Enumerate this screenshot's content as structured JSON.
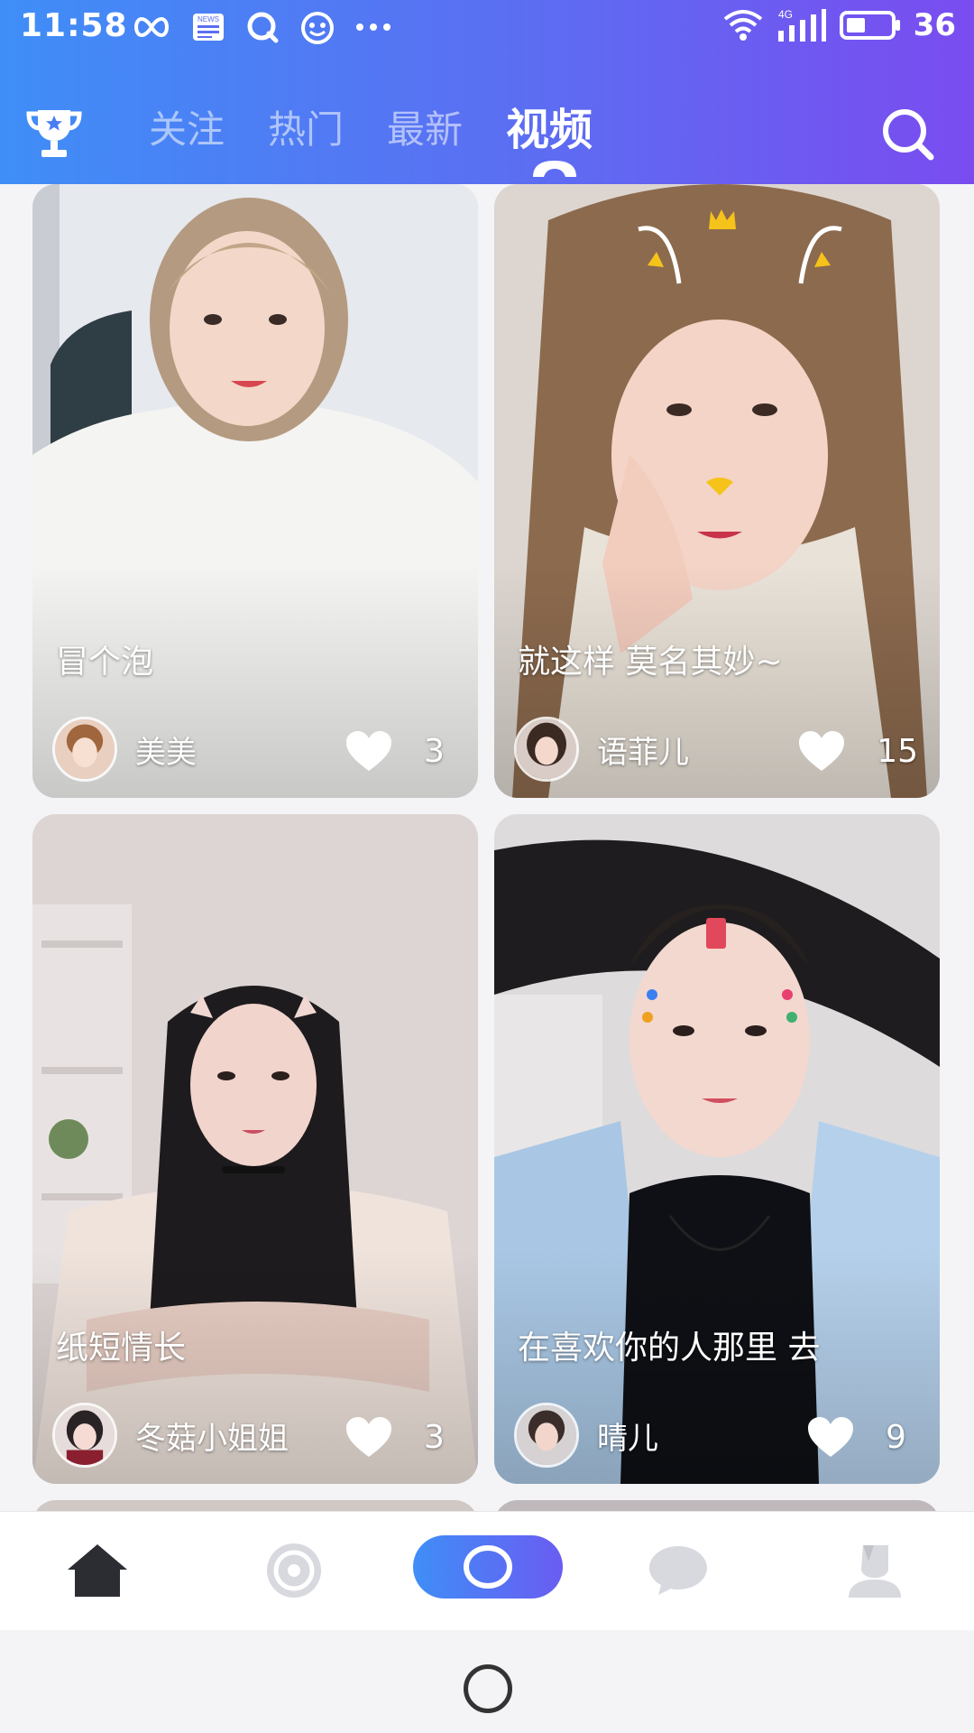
{
  "status_bar": {
    "time": "11:58",
    "battery": "36",
    "news_label": "NEWS",
    "network_label": "4G",
    "icons_left": [
      "loop-icon",
      "news-icon",
      "chat-bubble-q-icon",
      "emoji-icon",
      "more-dots-icon"
    ],
    "icons_right": [
      "wifi-icon",
      "signal-icon",
      "battery-icon"
    ]
  },
  "header": {
    "tabs": [
      {
        "label": "关注",
        "active": false
      },
      {
        "label": "热门",
        "active": false
      },
      {
        "label": "最新",
        "active": false
      },
      {
        "label": "视频",
        "active": true
      }
    ],
    "left_icon": "trophy-icon",
    "right_icon": "search-icon"
  },
  "feed": {
    "cards": [
      {
        "title": "冒个泡",
        "username": "美美",
        "likes": "3"
      },
      {
        "title": "就这样 莫名其妙~",
        "username": "语菲儿",
        "likes": "15"
      },
      {
        "title": "纸短情长",
        "username": "冬菇小姐姐",
        "likes": "3"
      },
      {
        "title": "在喜欢你的人那里 去",
        "username": "晴儿",
        "likes": "9"
      }
    ]
  },
  "bottom_nav": {
    "items": [
      "home-icon",
      "discover-icon",
      "live-icon",
      "message-icon",
      "profile-icon"
    ],
    "active": "home-icon"
  },
  "colors": {
    "header_start": "#3f8ef7",
    "header_end": "#7a4cf0",
    "nav_active": "#2b2d33",
    "nav_inactive": "#c8c9cf"
  }
}
